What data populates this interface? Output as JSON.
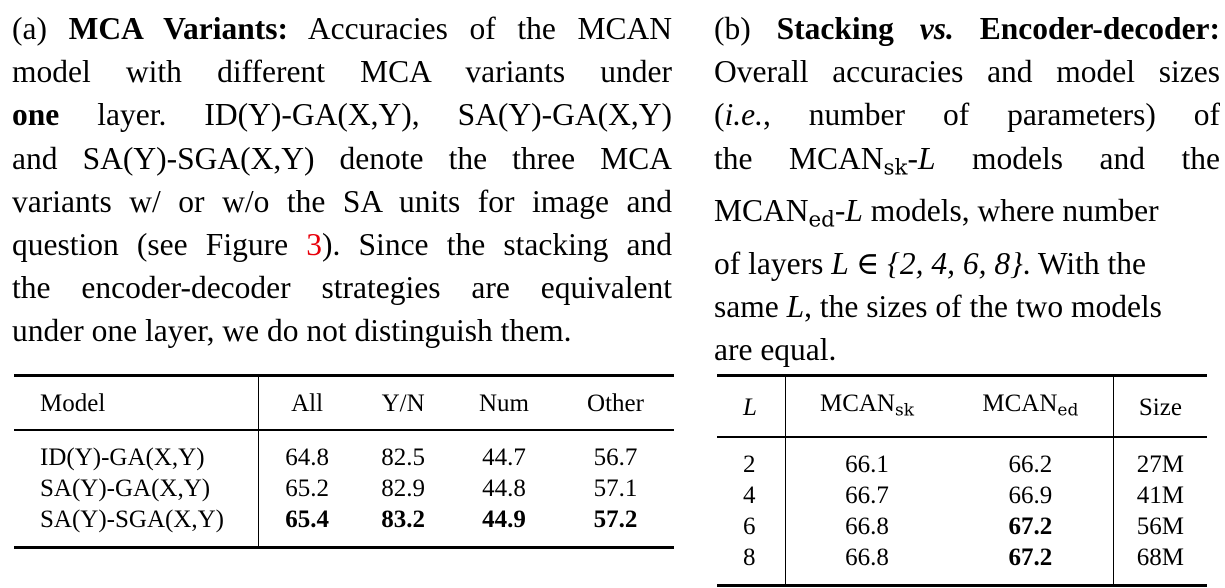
{
  "caption_a": {
    "label": "(a)",
    "title": "MCA Variants:",
    "line1_rest": "Accuracies of the MCAN",
    "line2": "model with different MCA variants under",
    "line3_bold": "one",
    "line3_rest": "layer. ID(Y)-GA(X,Y), SA(Y)-GA(X,Y)",
    "line4": "and SA(Y)-SGA(X,Y) denote the three MCA",
    "line5": "variants w/ or w/o the SA units for image and",
    "line6_pre": "question (see Figure",
    "line6_ref": "3",
    "line6_post": "). Since the stacking and",
    "line7": "the encoder-decoder strategies are equivalent",
    "line8": "under one layer, we do not distinguish them."
  },
  "caption_b": {
    "label": "(b)",
    "title_1": "Stacking",
    "title_vs": "vs.",
    "title_2": "Encoder-decoder:",
    "line2": "Overall accuracies and model sizes",
    "line3_open": "(",
    "line3_ie": "i.e.",
    "line3_rest": ", number of parameters) of",
    "line4_pre": "the MCAN",
    "line4_sub": "sk",
    "line4_L": "-L",
    "line4_post": "models and the",
    "line5_pre": "MCAN",
    "line5_sub": "ed",
    "line5_L": "-L",
    "line5_post": "models, where number",
    "line6_pre": "of layers",
    "line6_math": "L ∈ {2, 4, 6, 8}",
    "line6_post": ". With the",
    "line7_pre": "same",
    "line7_L": "L",
    "line7_post": ", the sizes of the two models",
    "line8": "are equal."
  },
  "table_a": {
    "headers": [
      "Model",
      "All",
      "Y/N",
      "Num",
      "Other"
    ],
    "rows": [
      {
        "model": "ID(Y)-GA(X,Y)",
        "all": "64.8",
        "yn": "82.5",
        "num": "44.7",
        "other": "56.7"
      },
      {
        "model": "SA(Y)-GA(X,Y)",
        "all": "65.2",
        "yn": "82.9",
        "num": "44.8",
        "other": "57.1"
      },
      {
        "model": "SA(Y)-SGA(X,Y)",
        "all": "65.4",
        "yn": "83.2",
        "num": "44.9",
        "other": "57.2"
      }
    ],
    "bold_row": 2
  },
  "table_b": {
    "headers": {
      "L": "L",
      "sk_base": "MCAN",
      "sk_sub": "sk",
      "ed_base": "MCAN",
      "ed_sub": "ed",
      "size": "Size"
    },
    "rows": [
      {
        "L": "2",
        "sk": "66.1",
        "ed": "66.2",
        "size": "27M"
      },
      {
        "L": "4",
        "sk": "66.7",
        "ed": "66.9",
        "size": "41M"
      },
      {
        "L": "6",
        "sk": "66.8",
        "ed": "67.2",
        "size": "56M"
      },
      {
        "L": "8",
        "sk": "66.8",
        "ed": "67.2",
        "size": "68M"
      }
    ],
    "bold_ed_rows": [
      2,
      3
    ]
  }
}
